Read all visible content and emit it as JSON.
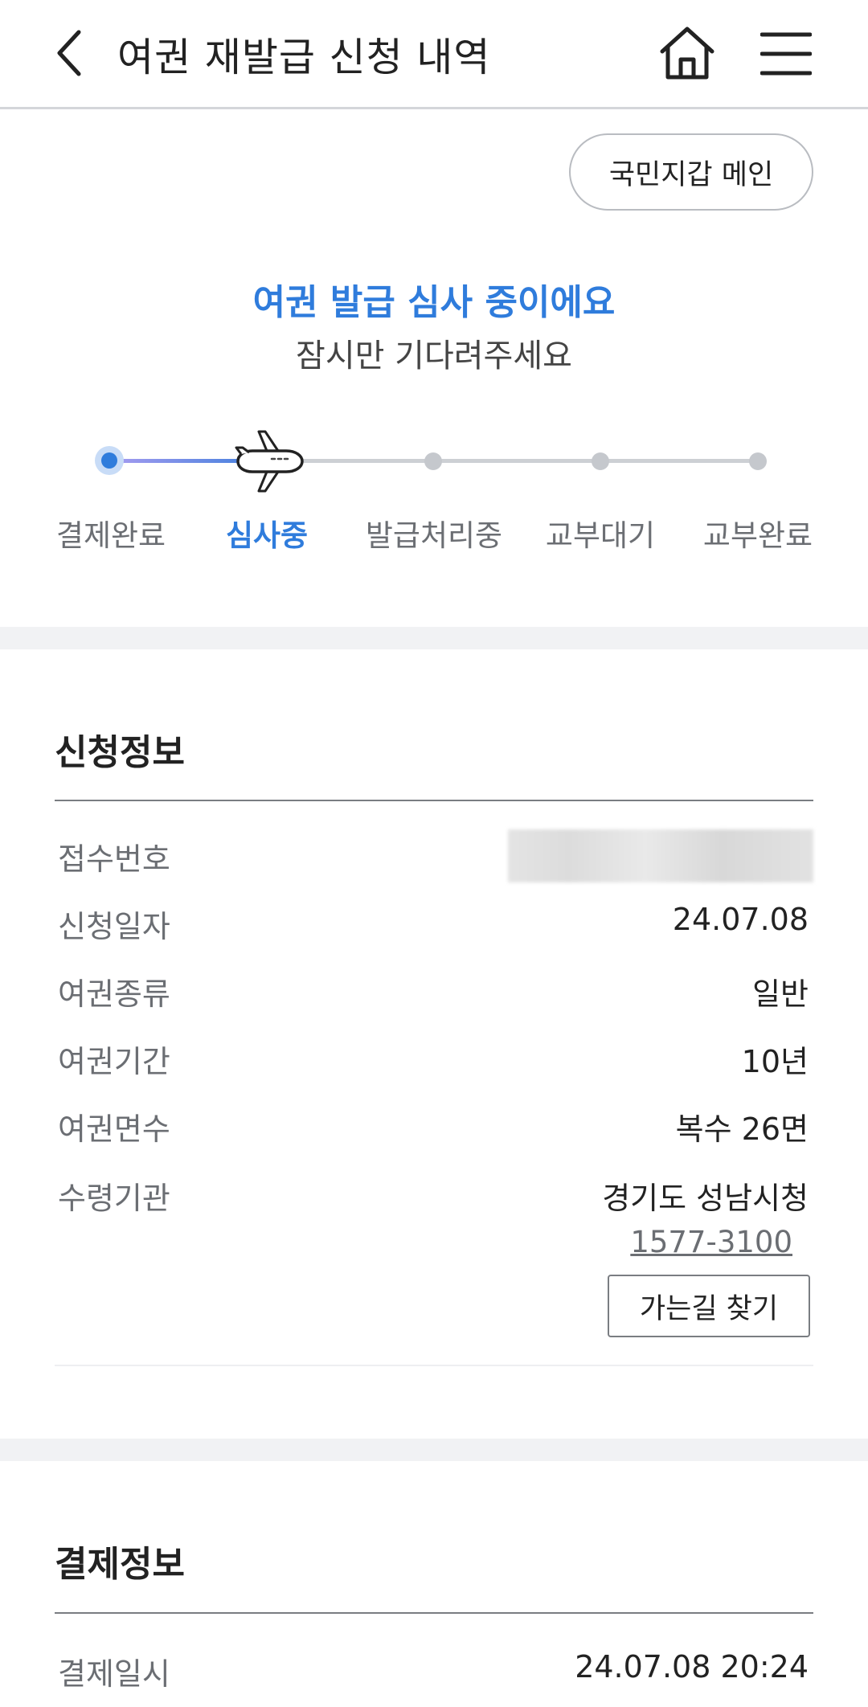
{
  "header": {
    "title": "여권 재발급 신청 내역",
    "back_icon": "chevron-left-icon",
    "home_icon": "home-icon",
    "menu_icon": "hamburger-menu-icon"
  },
  "wallet_button_label": "국민지갑 메인",
  "status": {
    "title": "여권 발급 심사 중이에요",
    "subtitle": "잠시만 기다려주세요",
    "accent_color": "#2f7cdc"
  },
  "progress": {
    "current_step_index": 1,
    "current_icon": "airplane-icon",
    "steps": [
      "결제완료",
      "심사중",
      "발급처리중",
      "교부대기",
      "교부완료"
    ]
  },
  "application_info": {
    "title": "신청정보",
    "receipt_number_label": "접수번호",
    "date_label": "신청일자",
    "date_value": "24.07.08",
    "type_label": "여권종류",
    "type_value": "일반",
    "period_label": "여권기간",
    "period_value": "10년",
    "pages_label": "여권면수",
    "pages_value": "복수 26면",
    "office_label": "수령기관",
    "office_value": "경기도 성남시청",
    "office_phone": "1577-3100",
    "directions_label": "가는길 찾기"
  },
  "payment_info": {
    "title": "결제정보",
    "datetime_label": "결제일시",
    "datetime_value": "24.07.08 20:24"
  }
}
